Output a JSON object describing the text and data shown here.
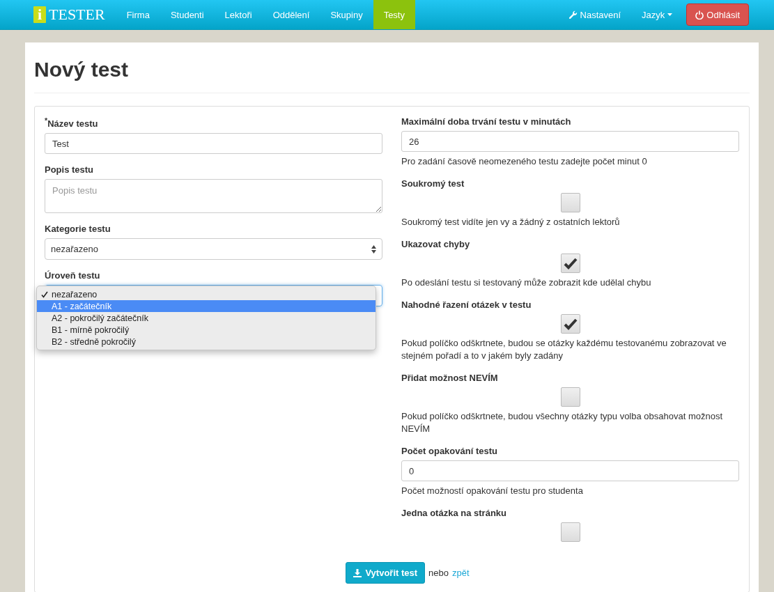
{
  "navbar": {
    "logo_letter": "i",
    "logo_text": "TESTER",
    "items": [
      {
        "label": "Firma",
        "selected": false
      },
      {
        "label": "Studenti",
        "selected": false
      },
      {
        "label": "Lektoři",
        "selected": false
      },
      {
        "label": "Oddělení",
        "selected": false
      },
      {
        "label": "Skupiny",
        "selected": false
      },
      {
        "label": "Testy",
        "selected": true
      }
    ],
    "settings": "Nastavení",
    "language": "Jazyk",
    "logout": "Odhlásit"
  },
  "page_title": "Nový test",
  "left": {
    "name_label": "$^{*}$Název testu",
    "name_value": "Test",
    "description_label": "Popis testu",
    "description_placeholder": "Popis testu",
    "category_label": "Kategorie testu",
    "category_value": "nezařazeno",
    "level_label": "Úroveň testu",
    "level_options": [
      {
        "label": "nezařazeno",
        "selected": true,
        "highlighted": false
      },
      {
        "label": "A1 - začátečník",
        "selected": false,
        "highlighted": true
      },
      {
        "label": "A2 - pokročilý začátečník",
        "selected": false,
        "highlighted": false
      },
      {
        "label": "B1 - mírně pokročilý",
        "selected": false,
        "highlighted": false
      },
      {
        "label": "B2 - středně pokročilý",
        "selected": false,
        "highlighted": false
      }
    ]
  },
  "right": [
    {
      "kind": "input",
      "label": "Maximální doba trvání testu v minutách",
      "value": "26",
      "help": "Pro zadání časově neomezeného testu zadejte počet minut 0"
    },
    {
      "kind": "checkbox",
      "label": "Soukromý test",
      "checked": false,
      "help": "Soukromý test vidíte jen vy a žádný z ostatních lektorů"
    },
    {
      "kind": "checkbox",
      "label": "Ukazovat chyby",
      "checked": true,
      "help": "Po odeslání testu si testovaný může zobrazit kde udělal chybu"
    },
    {
      "kind": "checkbox",
      "label": "Nahodné řazení otázek v testu",
      "checked": true,
      "help": "Pokud políčko odškrtnete, budou se otázky každému testovanému zobrazovat ve stejném pořadí a to v jakém byly zadány"
    },
    {
      "kind": "checkbox",
      "label": "Přidat možnost NEVÍM",
      "checked": false,
      "help": "Pokud políčko odškrtnete, budou všechny otázky typu volba obsahovat možnost NEVÍM"
    },
    {
      "kind": "input",
      "label": "Počet opakování testu",
      "value": "0",
      "help": "Počet možností opakování testu pro studenta"
    },
    {
      "kind": "checkbox",
      "label": "Jedna otázka na stránku",
      "checked": false
    }
  ],
  "submit": "Vytvořit test",
  "or_text": "nebo",
  "back_link": "zpět"
}
